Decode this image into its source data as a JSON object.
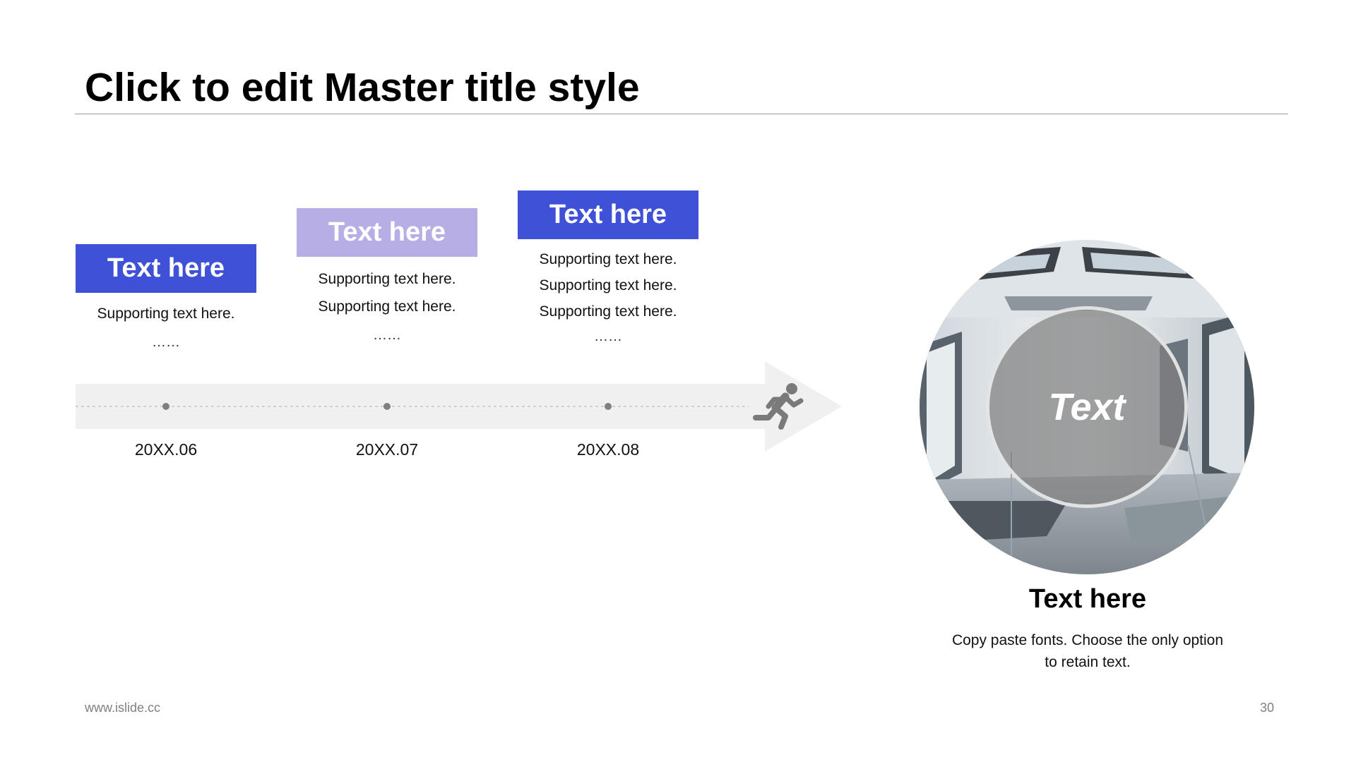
{
  "slide": {
    "title": "Click to edit Master title style",
    "footer_url": "www.islide.cc",
    "page_number": "30"
  },
  "timeline": {
    "items": [
      {
        "label": "Text here",
        "color": "#3F51D6",
        "lines": [
          "Supporting text here."
        ],
        "ellipsis": "……",
        "date": "20XX.06"
      },
      {
        "label": "Text here",
        "color": "#B7AEE6",
        "lines": [
          "Supporting text here.",
          "Supporting text here."
        ],
        "ellipsis": "……",
        "date": "20XX.07"
      },
      {
        "label": "Text here",
        "color": "#3F51D6",
        "lines": [
          "Supporting text here.",
          "Supporting text here.",
          "Supporting text here."
        ],
        "ellipsis": "……",
        "date": "20XX.08"
      }
    ],
    "runner_icon": "running-person-icon",
    "arrow_color": "#F0F0F0"
  },
  "feature": {
    "image": "office-interior-photo",
    "overlay_text": "Text",
    "title": "Text here",
    "body": "Copy paste fonts. Choose the only option to retain text."
  }
}
